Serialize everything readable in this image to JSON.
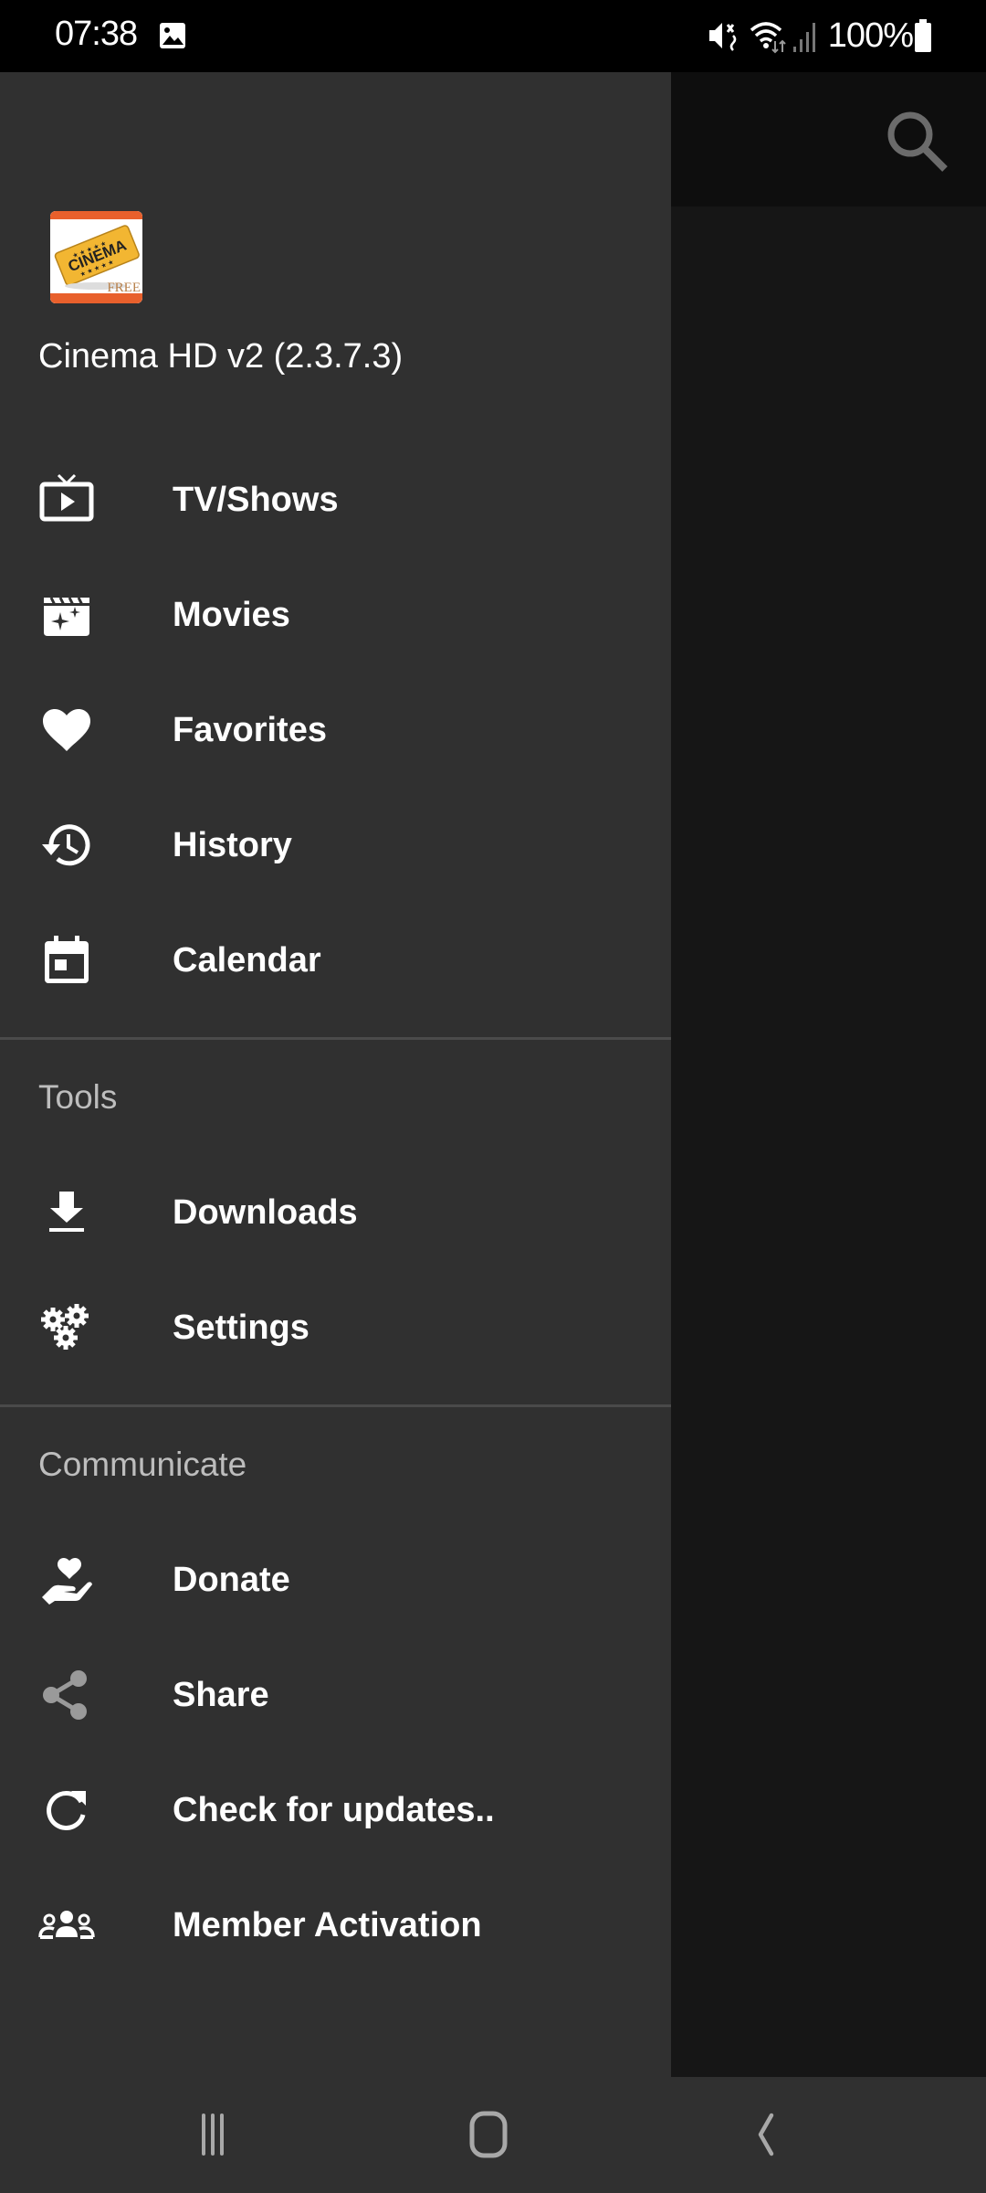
{
  "status_bar": {
    "time": "07:38",
    "battery_percent": "100%",
    "icons": [
      "gallery-icon",
      "mute-icon",
      "wifi-icon",
      "signal-icon",
      "battery-icon"
    ]
  },
  "app": {
    "title": "Cinema HD v2 (2.3.7.3)",
    "logo_text": "CINEMA",
    "logo_badge": "FREE",
    "search_icon": "search-icon"
  },
  "drawer": {
    "main_items": [
      {
        "label": "TV/Shows",
        "icon": "tv-icon"
      },
      {
        "label": "Movies",
        "icon": "movie-clapper-icon"
      },
      {
        "label": "Favorites",
        "icon": "heart-icon"
      },
      {
        "label": "History",
        "icon": "history-icon"
      },
      {
        "label": "Calendar",
        "icon": "calendar-icon"
      }
    ],
    "sections": [
      {
        "title": "Tools",
        "items": [
          {
            "label": "Downloads",
            "icon": "download-icon"
          },
          {
            "label": "Settings",
            "icon": "settings-gears-icon"
          }
        ]
      },
      {
        "title": "Communicate",
        "items": [
          {
            "label": "Donate",
            "icon": "donate-icon"
          },
          {
            "label": "Share",
            "icon": "share-icon"
          },
          {
            "label": "Check for updates..",
            "icon": "refresh-icon"
          },
          {
            "label": "Member Activation",
            "icon": "group-icon"
          }
        ]
      }
    ]
  },
  "nav_bar": {
    "recents_icon": "recents-icon",
    "home_icon": "home-icon",
    "back_icon": "back-icon"
  },
  "colors": {
    "drawer_bg": "#303030",
    "status_bar_bg": "#000000",
    "section_header": "#bdbdbd",
    "text": "#ffffff",
    "logo_accent": "#e8602c",
    "ticket": "#f2b632"
  }
}
